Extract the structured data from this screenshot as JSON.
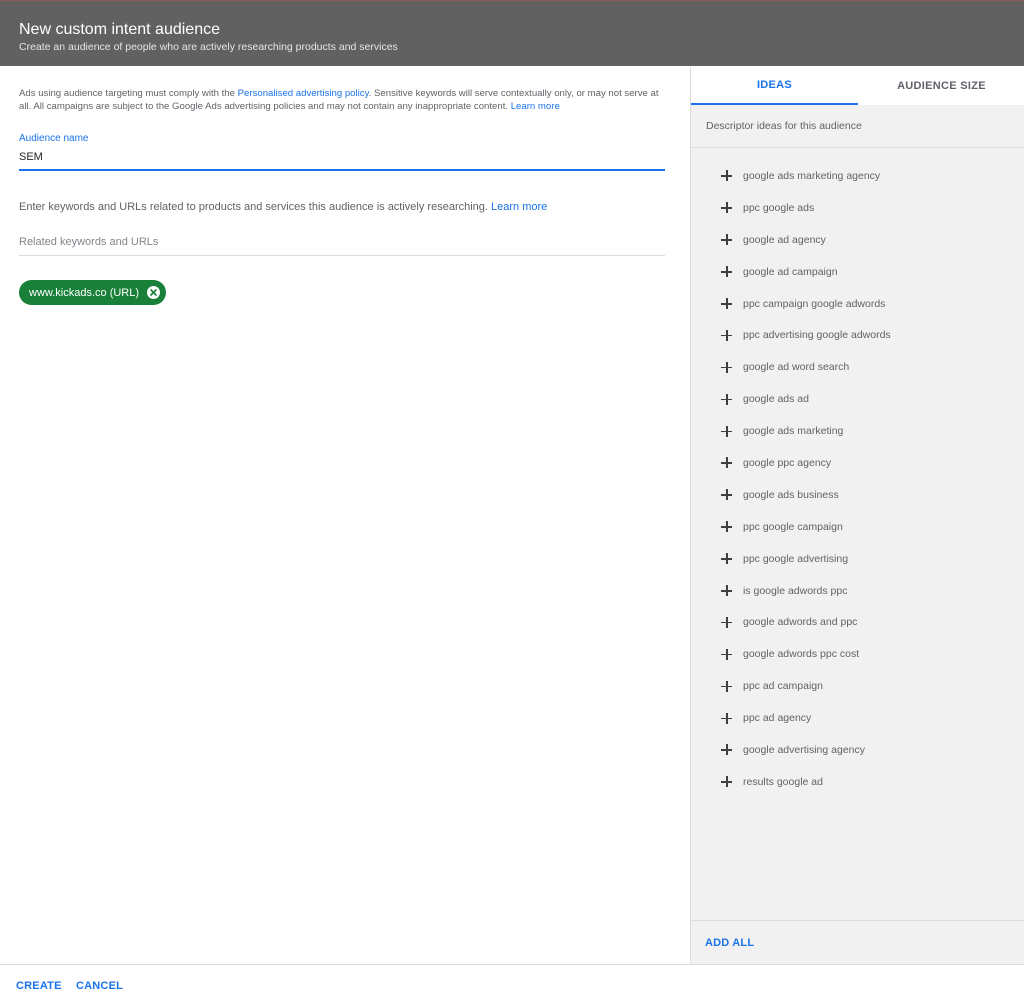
{
  "header": {
    "title": "New custom intent audience",
    "subtitle": "Create an audience of people who are actively researching products and services"
  },
  "notice": {
    "text_before": "Ads using audience targeting must comply with the ",
    "policy_link": "Personalised advertising policy",
    "text_after": ". Sensitive keywords will serve contextually only, or may not serve at all. All campaigns are subject to the Google Ads advertising policies and may not contain any inappropriate content. ",
    "learn_more": "Learn more"
  },
  "audience_name": {
    "label": "Audience name",
    "value": "SEM"
  },
  "keywords": {
    "instruction": "Enter keywords and URLs related to products and services this audience is actively researching. ",
    "learn_more": "Learn more",
    "placeholder": "Related keywords and URLs"
  },
  "chips": [
    {
      "label": "www.kickads.co (URL)"
    }
  ],
  "tabs": {
    "ideas": "IDEAS",
    "audience_size": "AUDIENCE SIZE"
  },
  "ideas_panel": {
    "description": "Descriptor ideas for this audience",
    "items": [
      "google ads marketing agency",
      "ppc google ads",
      "google ad agency",
      "google ad campaign",
      "ppc campaign google adwords",
      "ppc advertising google adwords",
      "google ad word search",
      "google ads ad",
      "google ads marketing",
      "google ppc agency",
      "google ads business",
      "ppc google campaign",
      "ppc google advertising",
      "is google adwords ppc",
      "google adwords and ppc",
      "google adwords ppc cost",
      "ppc ad campaign",
      "ppc ad agency",
      "google advertising agency",
      "results google ad"
    ],
    "add_all": "ADD ALL"
  },
  "footer": {
    "create": "CREATE",
    "cancel": "CANCEL"
  },
  "colors": {
    "header_bg": "#616161",
    "accent": "#1a73e8",
    "chip_green": "#188038"
  }
}
